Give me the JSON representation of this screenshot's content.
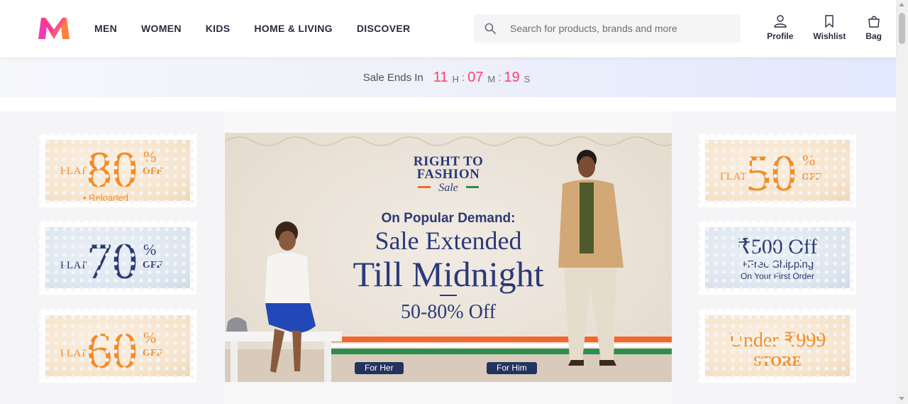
{
  "brand": {
    "logo": "myntra-logo"
  },
  "nav": {
    "items": [
      "MEN",
      "WOMEN",
      "KIDS",
      "HOME & LIVING",
      "DISCOVER"
    ]
  },
  "search": {
    "placeholder": "Search for products, brands and more",
    "value": ""
  },
  "actions": {
    "profile": "Profile",
    "wishlist": "Wishlist",
    "bag": "Bag"
  },
  "sale_timer": {
    "label": "Sale Ends In",
    "hours": "11",
    "h": "H",
    "minutes": "07",
    "m": "M",
    "seconds": "19",
    "s": "S",
    "separator": ":"
  },
  "left_tiles": [
    {
      "flat": "FLAT",
      "value": "80",
      "pct": "%",
      "off": "OFF",
      "sub": "• Reloaded"
    },
    {
      "flat": "FLAT",
      "value": "70",
      "pct": "%",
      "off": "OFF"
    },
    {
      "flat": "FLAT",
      "value": "60",
      "pct": "%",
      "off": "OFF"
    }
  ],
  "right_tiles": [
    {
      "flat": "FLAT",
      "value": "50",
      "pct": "%",
      "off": "OFF"
    },
    {
      "line1": "₹500 Off",
      "line2": "+Free Shipping",
      "line3": "On Your First Order"
    },
    {
      "line1": "Under ₹999",
      "line2": "STORE"
    }
  ],
  "hero": {
    "brand_line1": "RIGHT TO",
    "brand_line2": "FASHION",
    "brand_line3": "Sale",
    "demand": "On Popular Demand:",
    "extended": "Sale Extended",
    "till": "Till Midnight",
    "discount": "50-80% Off",
    "for_her": "For Her",
    "for_him": "For Him"
  },
  "colors": {
    "accent": "#ff3f6c",
    "orange": "#f38b28",
    "navy": "#2b3c72"
  }
}
